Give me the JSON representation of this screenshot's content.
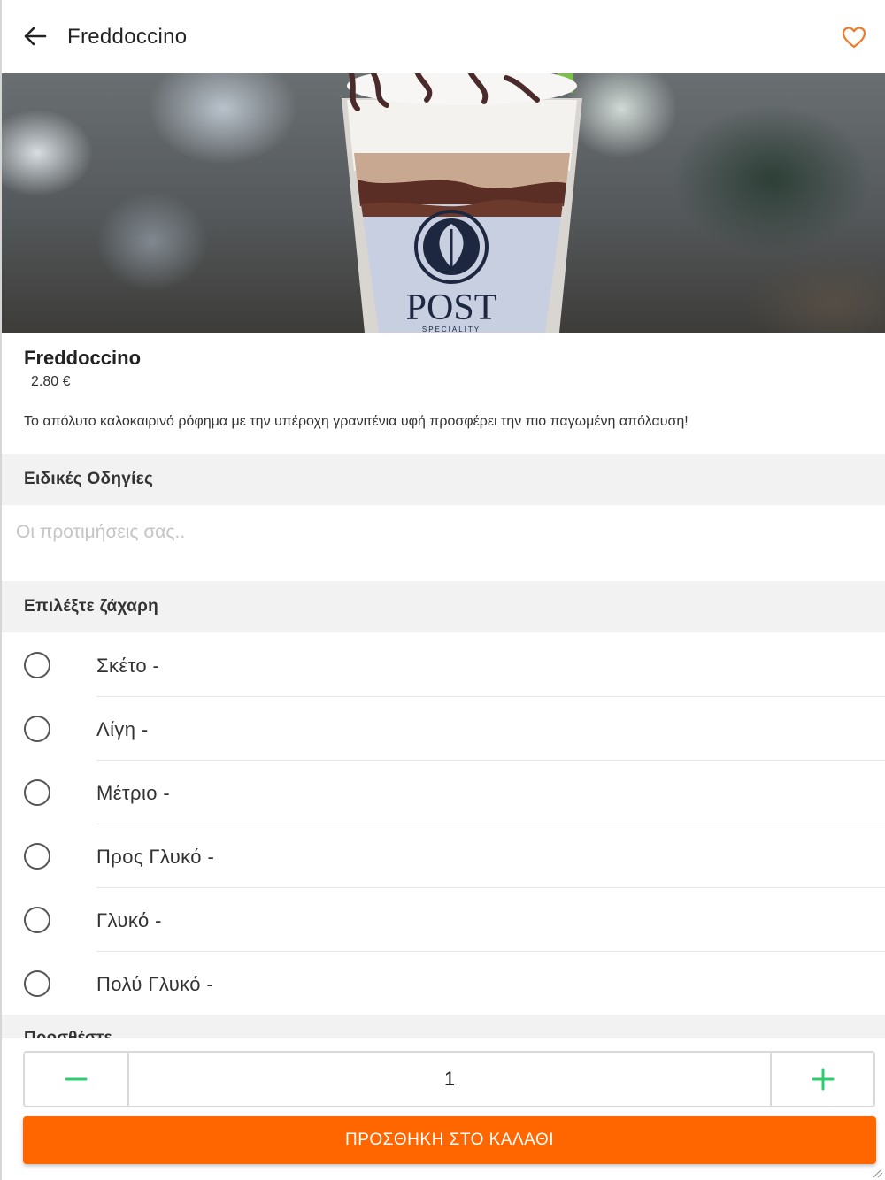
{
  "header": {
    "title": "Freddoccino",
    "back_icon": "arrow-left-icon",
    "favorite_icon": "heart-outline-icon"
  },
  "hero": {
    "cup_text": "POST",
    "cup_subtext": "SPECIALITY"
  },
  "product": {
    "name": "Freddoccino",
    "price": "2.80 €",
    "description": "Το απόλυτο καλοκαιρινό ρόφημα με την υπέροχη γρανιτένια υφή προσφέρει την πιο παγωμένη απόλαυση!"
  },
  "special_instructions": {
    "title": "Ειδικές Οδηγίες",
    "placeholder": "Οι προτιμήσεις σας..",
    "value": ""
  },
  "sugar": {
    "title": "Επιλέξτε ζάχαρη",
    "options": [
      {
        "label": "Σκέτο  -"
      },
      {
        "label": "Λίγη  -"
      },
      {
        "label": "Μέτριο  -"
      },
      {
        "label": "Προς Γλυκό  -"
      },
      {
        "label": "Γλυκό  -"
      },
      {
        "label": "Πολύ Γλυκό  -"
      }
    ]
  },
  "next_section": {
    "title": "Προσθέστε"
  },
  "quantity": {
    "value": "1",
    "minus_icon": "minus-icon",
    "plus_icon": "plus-icon"
  },
  "cart": {
    "button_label": "ΠΡΟΣΘΗΚΗ ΣΤΟ ΚΑΛΑΘΙ"
  },
  "colors": {
    "accent": "#ff6600",
    "heart": "#f07a2b",
    "stepper": "#2ecc71",
    "section_bg": "#f2f2f2"
  }
}
